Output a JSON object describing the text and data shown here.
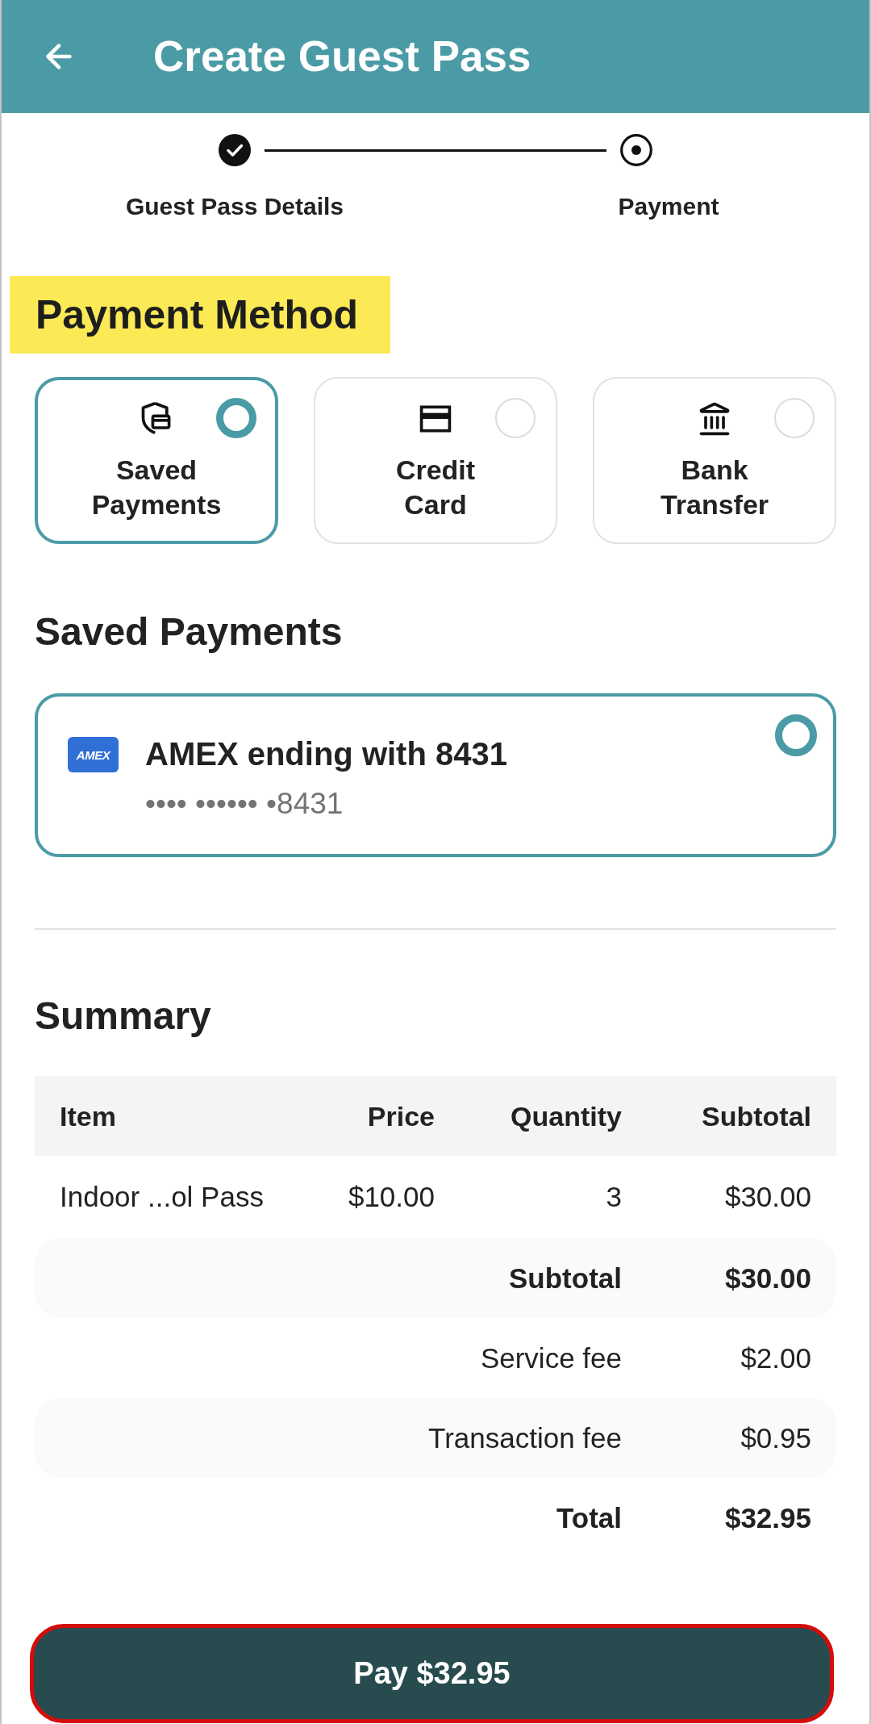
{
  "header": {
    "title": "Create Guest Pass"
  },
  "stepper": {
    "steps": [
      {
        "label": "Guest Pass Details",
        "completed": true
      },
      {
        "label": "Payment",
        "completed": false
      }
    ]
  },
  "payment_method": {
    "heading": "Payment Method",
    "highlighted": true,
    "options": [
      {
        "kind": "saved",
        "label": "Saved Payments",
        "selected": true
      },
      {
        "kind": "card",
        "label": "Credit Card",
        "selected": false
      },
      {
        "kind": "bank",
        "label": "Bank Transfer",
        "selected": false
      }
    ]
  },
  "saved_payments": {
    "heading": "Saved Payments",
    "cards": [
      {
        "brand": "AMEX",
        "title": "AMEX ending with 8431",
        "masked_number": "•••• •••••• •8431",
        "selected": true
      }
    ]
  },
  "summary": {
    "heading": "Summary",
    "table": {
      "columns": [
        "Item",
        "Price",
        "Quantity",
        "Subtotal"
      ],
      "rows": [
        [
          "Indoor ...ol Pass",
          "$10.00",
          "3",
          "$30.00"
        ]
      ]
    },
    "totals": [
      {
        "label": "Subtotal",
        "value": "$30.00",
        "emphasis": true
      },
      {
        "label": "Service fee",
        "value": "$2.00",
        "emphasis": false
      },
      {
        "label": "Transaction fee",
        "value": "$0.95",
        "emphasis": false
      },
      {
        "label": "Total",
        "value": "$32.95",
        "emphasis": true
      }
    ]
  },
  "pay_button": {
    "label": "Pay $32.95",
    "highlighted": true
  }
}
